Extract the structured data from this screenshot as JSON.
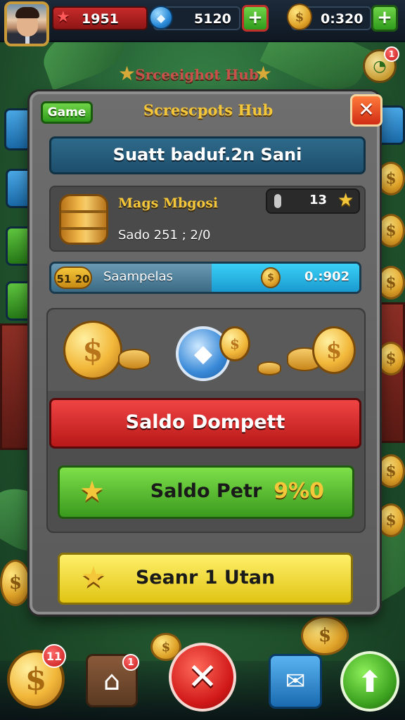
{
  "hud": {
    "level_value": "1951",
    "gems_value": "5120",
    "coins_value": "0:320",
    "plus_symbol": "+",
    "star_icon": "star-icon",
    "gem_icon": "gem-icon",
    "coin_icon": "coin-icon"
  },
  "background": {
    "title": "Srceeighot Hub"
  },
  "modal": {
    "tag": "Game",
    "title": "Screscpots Hub",
    "close_symbol": "✕",
    "banner": "Suatt baduf.2n Sani",
    "item": {
      "name": "Mags Mbgosi",
      "sub": "Sado 251 ; 2/0",
      "chip_value": "13"
    },
    "progress": {
      "badge": "51 20",
      "label": "Saampelas",
      "value": "0.:902",
      "fill_fraction": 0.48
    },
    "buttons": {
      "red_label": "Saldo Dompett",
      "green_label": "Saldo Petr",
      "green_pct": "9%0",
      "yellow_label": "Seanr 1 Utan"
    }
  },
  "nav": {
    "coin_badge": "11",
    "home_badge": "1",
    "clock_badge": "1"
  },
  "colors": {
    "accent_gold": "#f4c63a",
    "danger_red": "#d01818",
    "success_green": "#3a9a1e",
    "panel_gray": "#5a5a5a"
  }
}
